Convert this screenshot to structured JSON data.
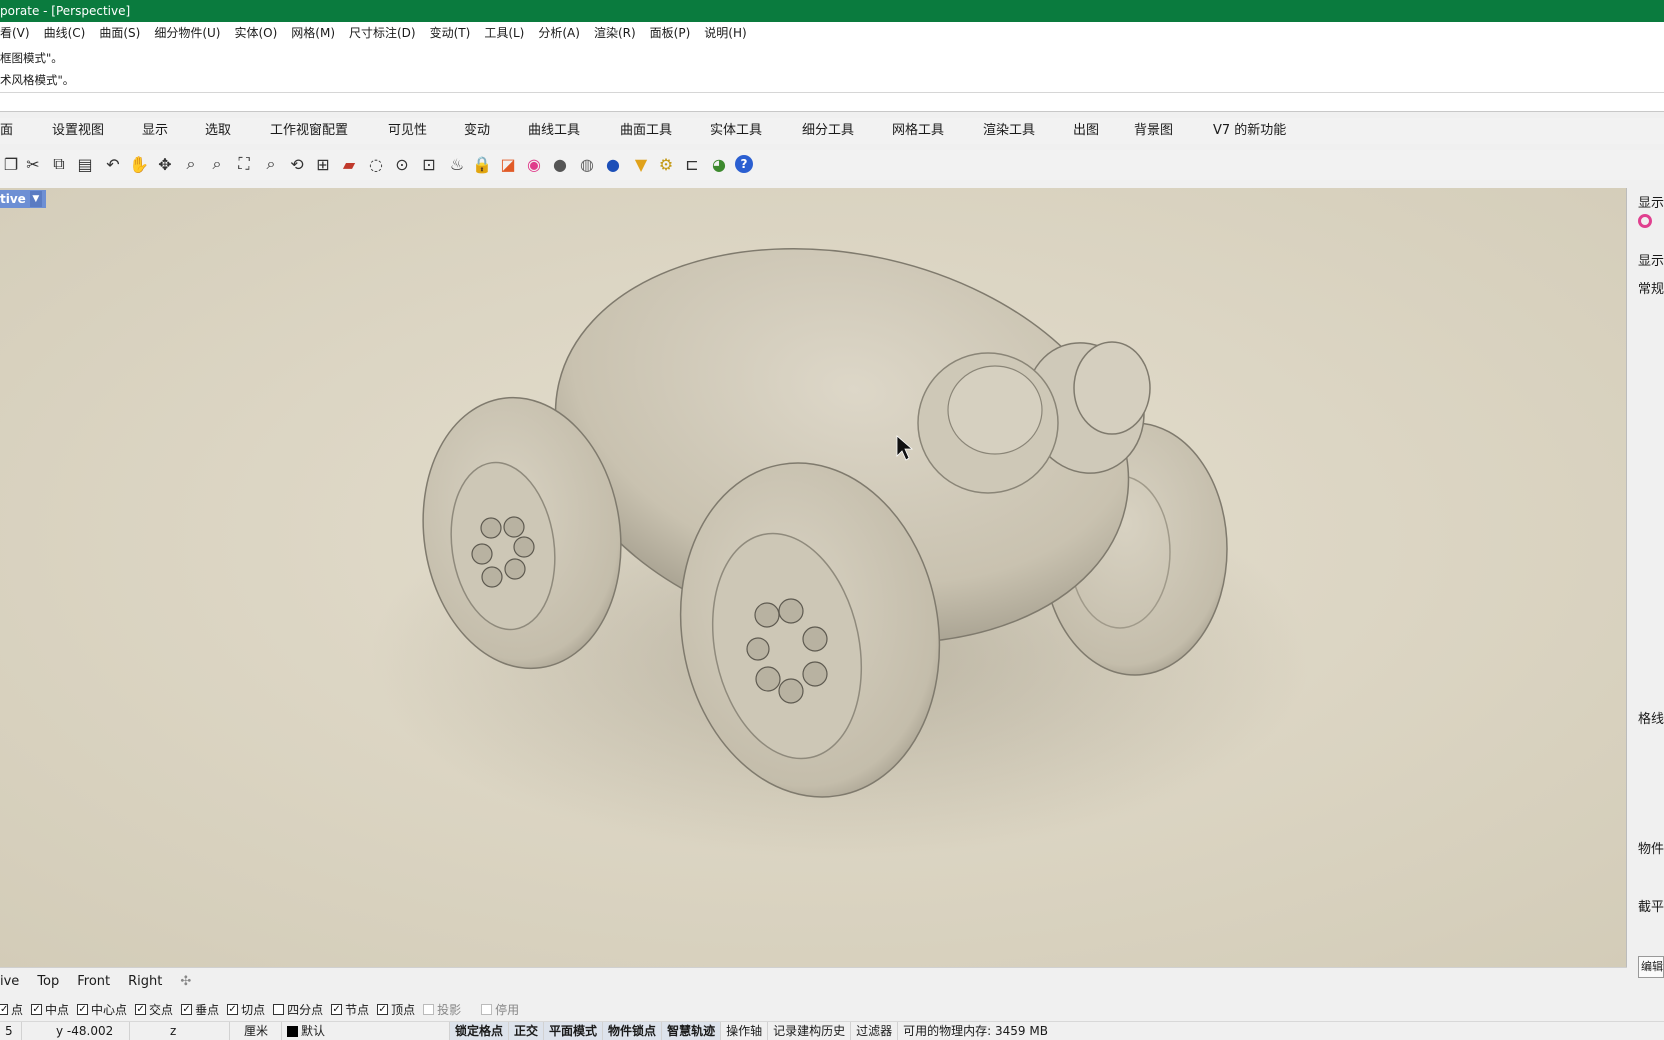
{
  "window": {
    "title": "porate - [Perspective]"
  },
  "menu": [
    "看(V)",
    "曲线(C)",
    "曲面(S)",
    "细分物件(U)",
    "实体(O)",
    "网格(M)",
    "尺寸标注(D)",
    "变动(T)",
    "工具(L)",
    "分析(A)",
    "渲染(R)",
    "面板(P)",
    "说明(H)"
  ],
  "command_history": [
    "框图模式\"。",
    "术风格模式\"。"
  ],
  "tabs": [
    "面",
    "设置视图",
    "显示",
    "选取",
    "工作视窗配置",
    "可见性",
    "变动",
    "曲线工具",
    "曲面工具",
    "实体工具",
    "细分工具",
    "网格工具",
    "渲染工具",
    "出图",
    "背景图",
    "V7 的新功能"
  ],
  "toolbar_icons": [
    "new-icon",
    "cut-icon",
    "copy-icon",
    "paste-icon",
    "undo-icon",
    "pan-hand-icon",
    "rotate-view-icon",
    "zoom-icon",
    "zoom-window-icon",
    "zoom-extents-icon",
    "zoom-selected-icon",
    "rotate-icon",
    "viewport-layout-icon",
    "car-icon",
    "hide-icon",
    "snap-icon",
    "point-icon",
    "light-icon",
    "lock-icon",
    "layer-icon",
    "color-wheel-icon",
    "shaded-sphere-icon",
    "render-sphere-icon",
    "material-sphere-icon",
    "dimension-icon",
    "settings-gear-icon",
    "grid-snap-icon",
    "globe-icon",
    "help-icon"
  ],
  "viewport": {
    "label": "tive",
    "background": "#d9d2bf"
  },
  "right_panel": {
    "header": "显示",
    "items": [
      "显示",
      "常规",
      "格线",
      "物件",
      "截平"
    ],
    "button": "编辑"
  },
  "viewport_tabs": [
    "ive",
    "Top",
    "Front",
    "Right"
  ],
  "osnaps": [
    {
      "label": "点",
      "checked": true,
      "enabled": true
    },
    {
      "label": "中点",
      "checked": true,
      "enabled": true
    },
    {
      "label": "中心点",
      "checked": true,
      "enabled": true
    },
    {
      "label": "交点",
      "checked": true,
      "enabled": true
    },
    {
      "label": "垂点",
      "checked": true,
      "enabled": true
    },
    {
      "label": "切点",
      "checked": true,
      "enabled": true
    },
    {
      "label": "四分点",
      "checked": false,
      "enabled": true
    },
    {
      "label": "节点",
      "checked": true,
      "enabled": true
    },
    {
      "label": "顶点",
      "checked": true,
      "enabled": true
    },
    {
      "label": "投影",
      "checked": false,
      "enabled": false
    },
    {
      "label": "停用",
      "checked": false,
      "enabled": false
    }
  ],
  "status": {
    "x_tail": "5",
    "y": "y -48.002",
    "z": "z",
    "units": "厘米",
    "layer": "默认",
    "toggles": [
      "锁定格点",
      "正交",
      "平面模式",
      "物件锁点",
      "智慧轨迹",
      "操作轴",
      "记录建构历史",
      "过滤器"
    ],
    "memory": "可用的物理内存: 3459 MB"
  }
}
